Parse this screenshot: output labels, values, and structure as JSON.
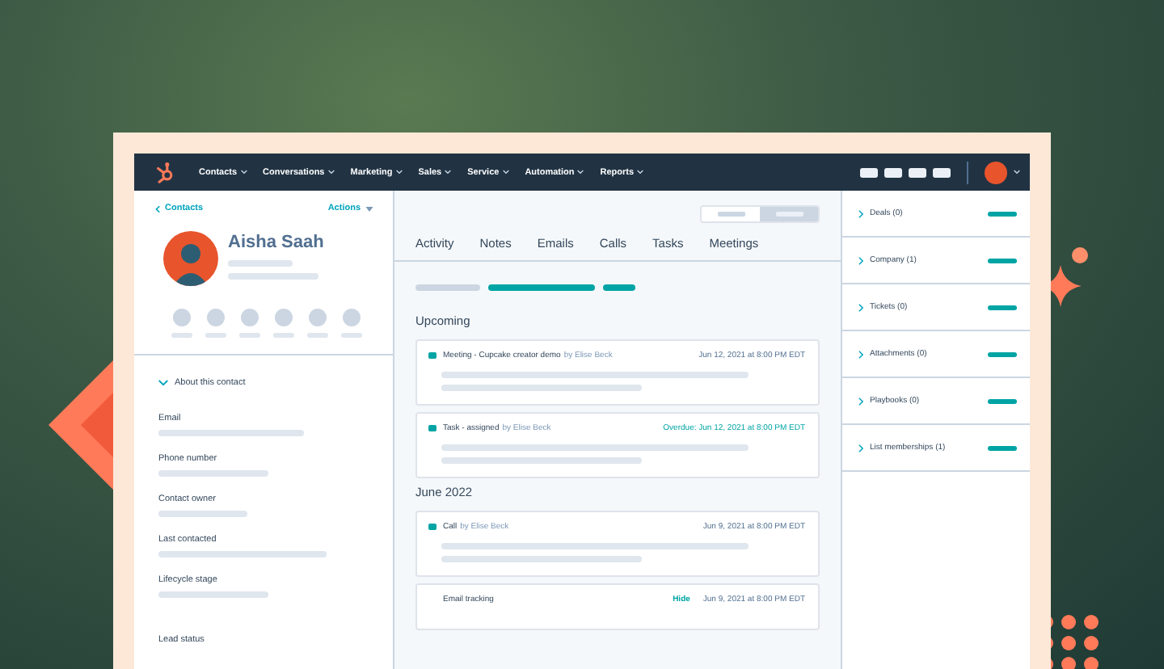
{
  "nav": {
    "items": [
      "Contacts",
      "Conversations",
      "Marketing",
      "Sales",
      "Service",
      "Automation",
      "Reports"
    ]
  },
  "contact": {
    "back_link": "Contacts",
    "actions": "Actions",
    "name": "Aisha Saah",
    "about_heading": "About this contact",
    "fields": [
      "Email",
      "Phone number",
      "Contact owner",
      "Last contacted",
      "Lifecycle stage",
      "Lead status"
    ]
  },
  "tabs": [
    "Activity",
    "Notes",
    "Emails",
    "Calls",
    "Tasks",
    "Meetings"
  ],
  "timeline": [
    {
      "heading": "Upcoming",
      "entries": [
        {
          "kind": "activity",
          "title": "Meeting - Cupcake creator demo",
          "byline": "by Elise Beck",
          "date": "Jun 12, 2021 at 8:00 PM EDT",
          "overdue": false
        },
        {
          "kind": "activity",
          "title": "Task - assigned",
          "byline": "by Elise Beck",
          "date": "Overdue: Jun 12, 2021 at 8:00 PM EDT",
          "overdue": true
        }
      ]
    },
    {
      "heading": "June 2022",
      "entries": [
        {
          "kind": "activity",
          "title": "Call",
          "byline": "by Elise Beck",
          "date": "Jun 9, 2021 at 8:00 PM EDT",
          "overdue": false
        },
        {
          "kind": "tracking",
          "title": "Email tracking",
          "action": "Hide",
          "date": "Jun 9, 2021 at 8:00 PM EDT",
          "overdue": false
        }
      ]
    }
  ],
  "sidebar": {
    "sections": [
      "Deals (0)",
      "Company (1)",
      "Tickets (0)",
      "Attachments (0)",
      "Playbooks (0)",
      "List memberships (1)"
    ]
  }
}
